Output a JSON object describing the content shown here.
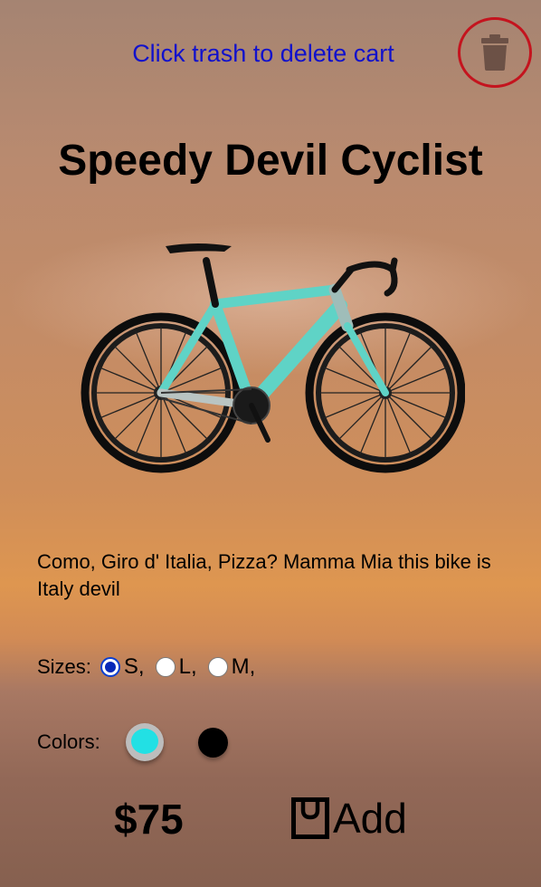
{
  "header": {
    "hint": "Click trash to delete cart",
    "trash_icon": "trash-icon"
  },
  "product": {
    "title": "Speedy Devil Cyclist",
    "image_icon": "bicycle-image",
    "description": "Como, Giro d' Italia, Pizza? Mamma Mia this bike is Italy devil",
    "price": "$75"
  },
  "sizes": {
    "label": "Sizes:",
    "options": [
      {
        "label": "S,",
        "checked": true
      },
      {
        "label": "L,",
        "checked": false
      },
      {
        "label": "M,",
        "checked": false
      }
    ]
  },
  "colors": {
    "label": "Colors:",
    "options": [
      {
        "value": "#22e0e4",
        "selected": true
      },
      {
        "value": "#000000",
        "selected": false
      }
    ]
  },
  "cart": {
    "add_label": "Add",
    "icon": "shopping-bag-icon"
  },
  "theme": {
    "accent": "#1111cc",
    "trash_ring": "#c4141e"
  }
}
